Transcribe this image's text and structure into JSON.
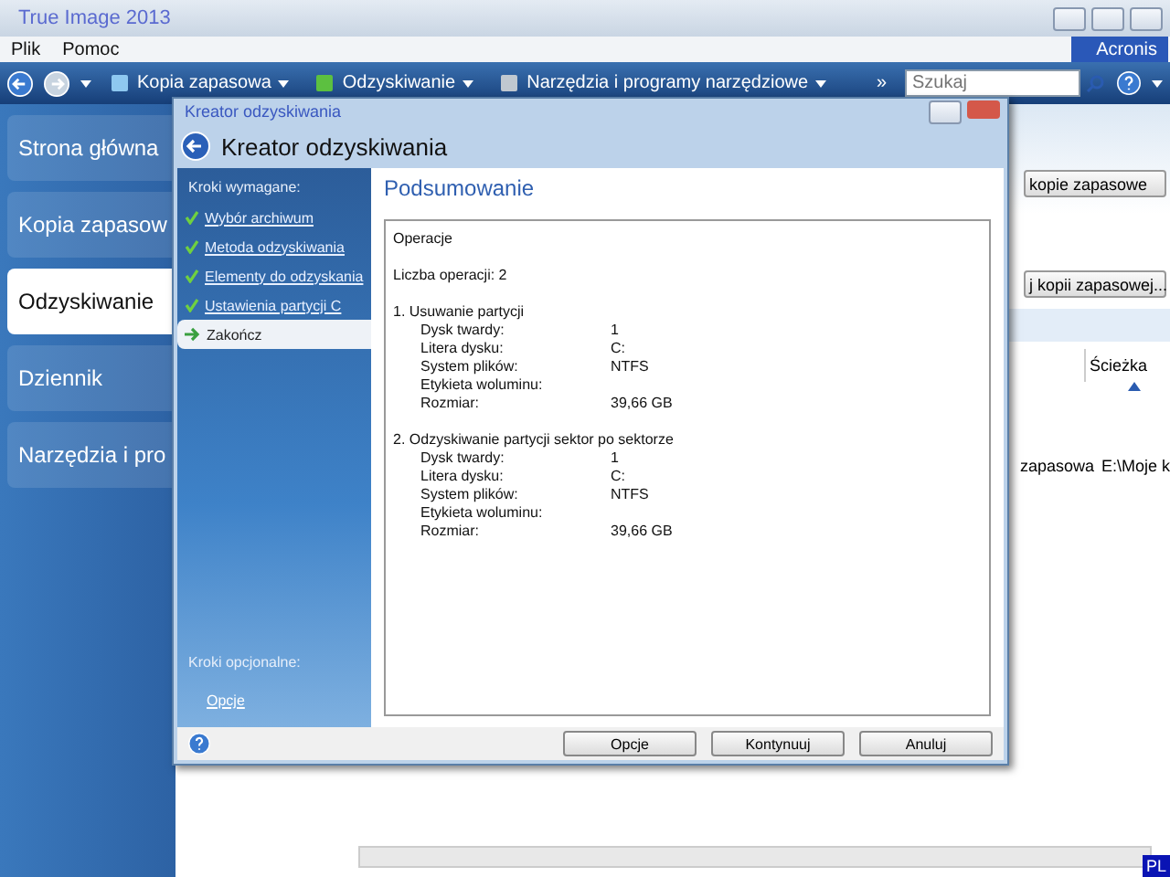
{
  "window": {
    "title": "True Image 2013",
    "brand": "Acronis"
  },
  "menu": [
    "Plik",
    "Pomoc"
  ],
  "toolbar": {
    "items": [
      {
        "label": "Kopia zapasowa"
      },
      {
        "label": "Odzyskiwanie"
      },
      {
        "label": "Narzędzia i programy narzędziowe"
      }
    ],
    "overflow": "»",
    "search": {
      "placeholder": "Szukaj"
    }
  },
  "nav": [
    {
      "label": "Strona główna",
      "selected": false
    },
    {
      "label": "Kopia zapasow",
      "selected": false
    },
    {
      "label": "Odzyskiwanie",
      "selected": true
    },
    {
      "label": "Dziennik",
      "selected": false
    },
    {
      "label": "Narzędzia i pro",
      "selected": false
    }
  ],
  "background": {
    "buttons": [
      "kopie zapasowe",
      "j kopii zapasowej..."
    ],
    "column": "Ścieżka",
    "row": [
      "zapasowa",
      "E:\\Moje k"
    ]
  },
  "dialog": {
    "caption": "Kreator odzyskiwania",
    "heading": "Kreator odzyskiwania",
    "required_label": "Kroki wymagane:",
    "steps": [
      {
        "label": "Wybór archiwum",
        "done": true,
        "selected": false
      },
      {
        "label": "Metoda odzyskiwania",
        "done": true,
        "selected": false
      },
      {
        "label": "Elementy do odzyskania",
        "done": true,
        "selected": false
      },
      {
        "label": "Ustawienia partycji C",
        "done": true,
        "selected": false
      },
      {
        "label": "Zakończ",
        "done": false,
        "selected": true
      }
    ],
    "optional_label": "Kroki opcjonalne:",
    "optional_link": "Opcje",
    "summary_title": "Podsumowanie",
    "summary": {
      "header": "Operacje",
      "count": "Liczba operacji: 2",
      "operations": [
        {
          "title": "1. Usuwanie partycji",
          "fields": [
            {
              "label": "Dysk twardy:",
              "value": "1"
            },
            {
              "label": "Litera dysku:",
              "value": "C:"
            },
            {
              "label": "System plików:",
              "value": "NTFS"
            },
            {
              "label": "Etykieta woluminu:"
            },
            {
              "label": "Rozmiar:",
              "value": "39,66 GB"
            }
          ]
        },
        {
          "title": "2. Odzyskiwanie partycji sektor po sektorze",
          "fields": [
            {
              "label": "Dysk twardy:",
              "value": "1"
            },
            {
              "label": "Litera dysku:",
              "value": "C:"
            },
            {
              "label": "System plików:",
              "value": "NTFS"
            },
            {
              "label": "Etykieta woluminu:"
            },
            {
              "label": "Rozmiar:",
              "value": "39,66 GB"
            }
          ]
        }
      ]
    },
    "buttons": [
      "Opcje",
      "Kontynuuj",
      "Anuluj"
    ]
  },
  "language": "PL"
}
